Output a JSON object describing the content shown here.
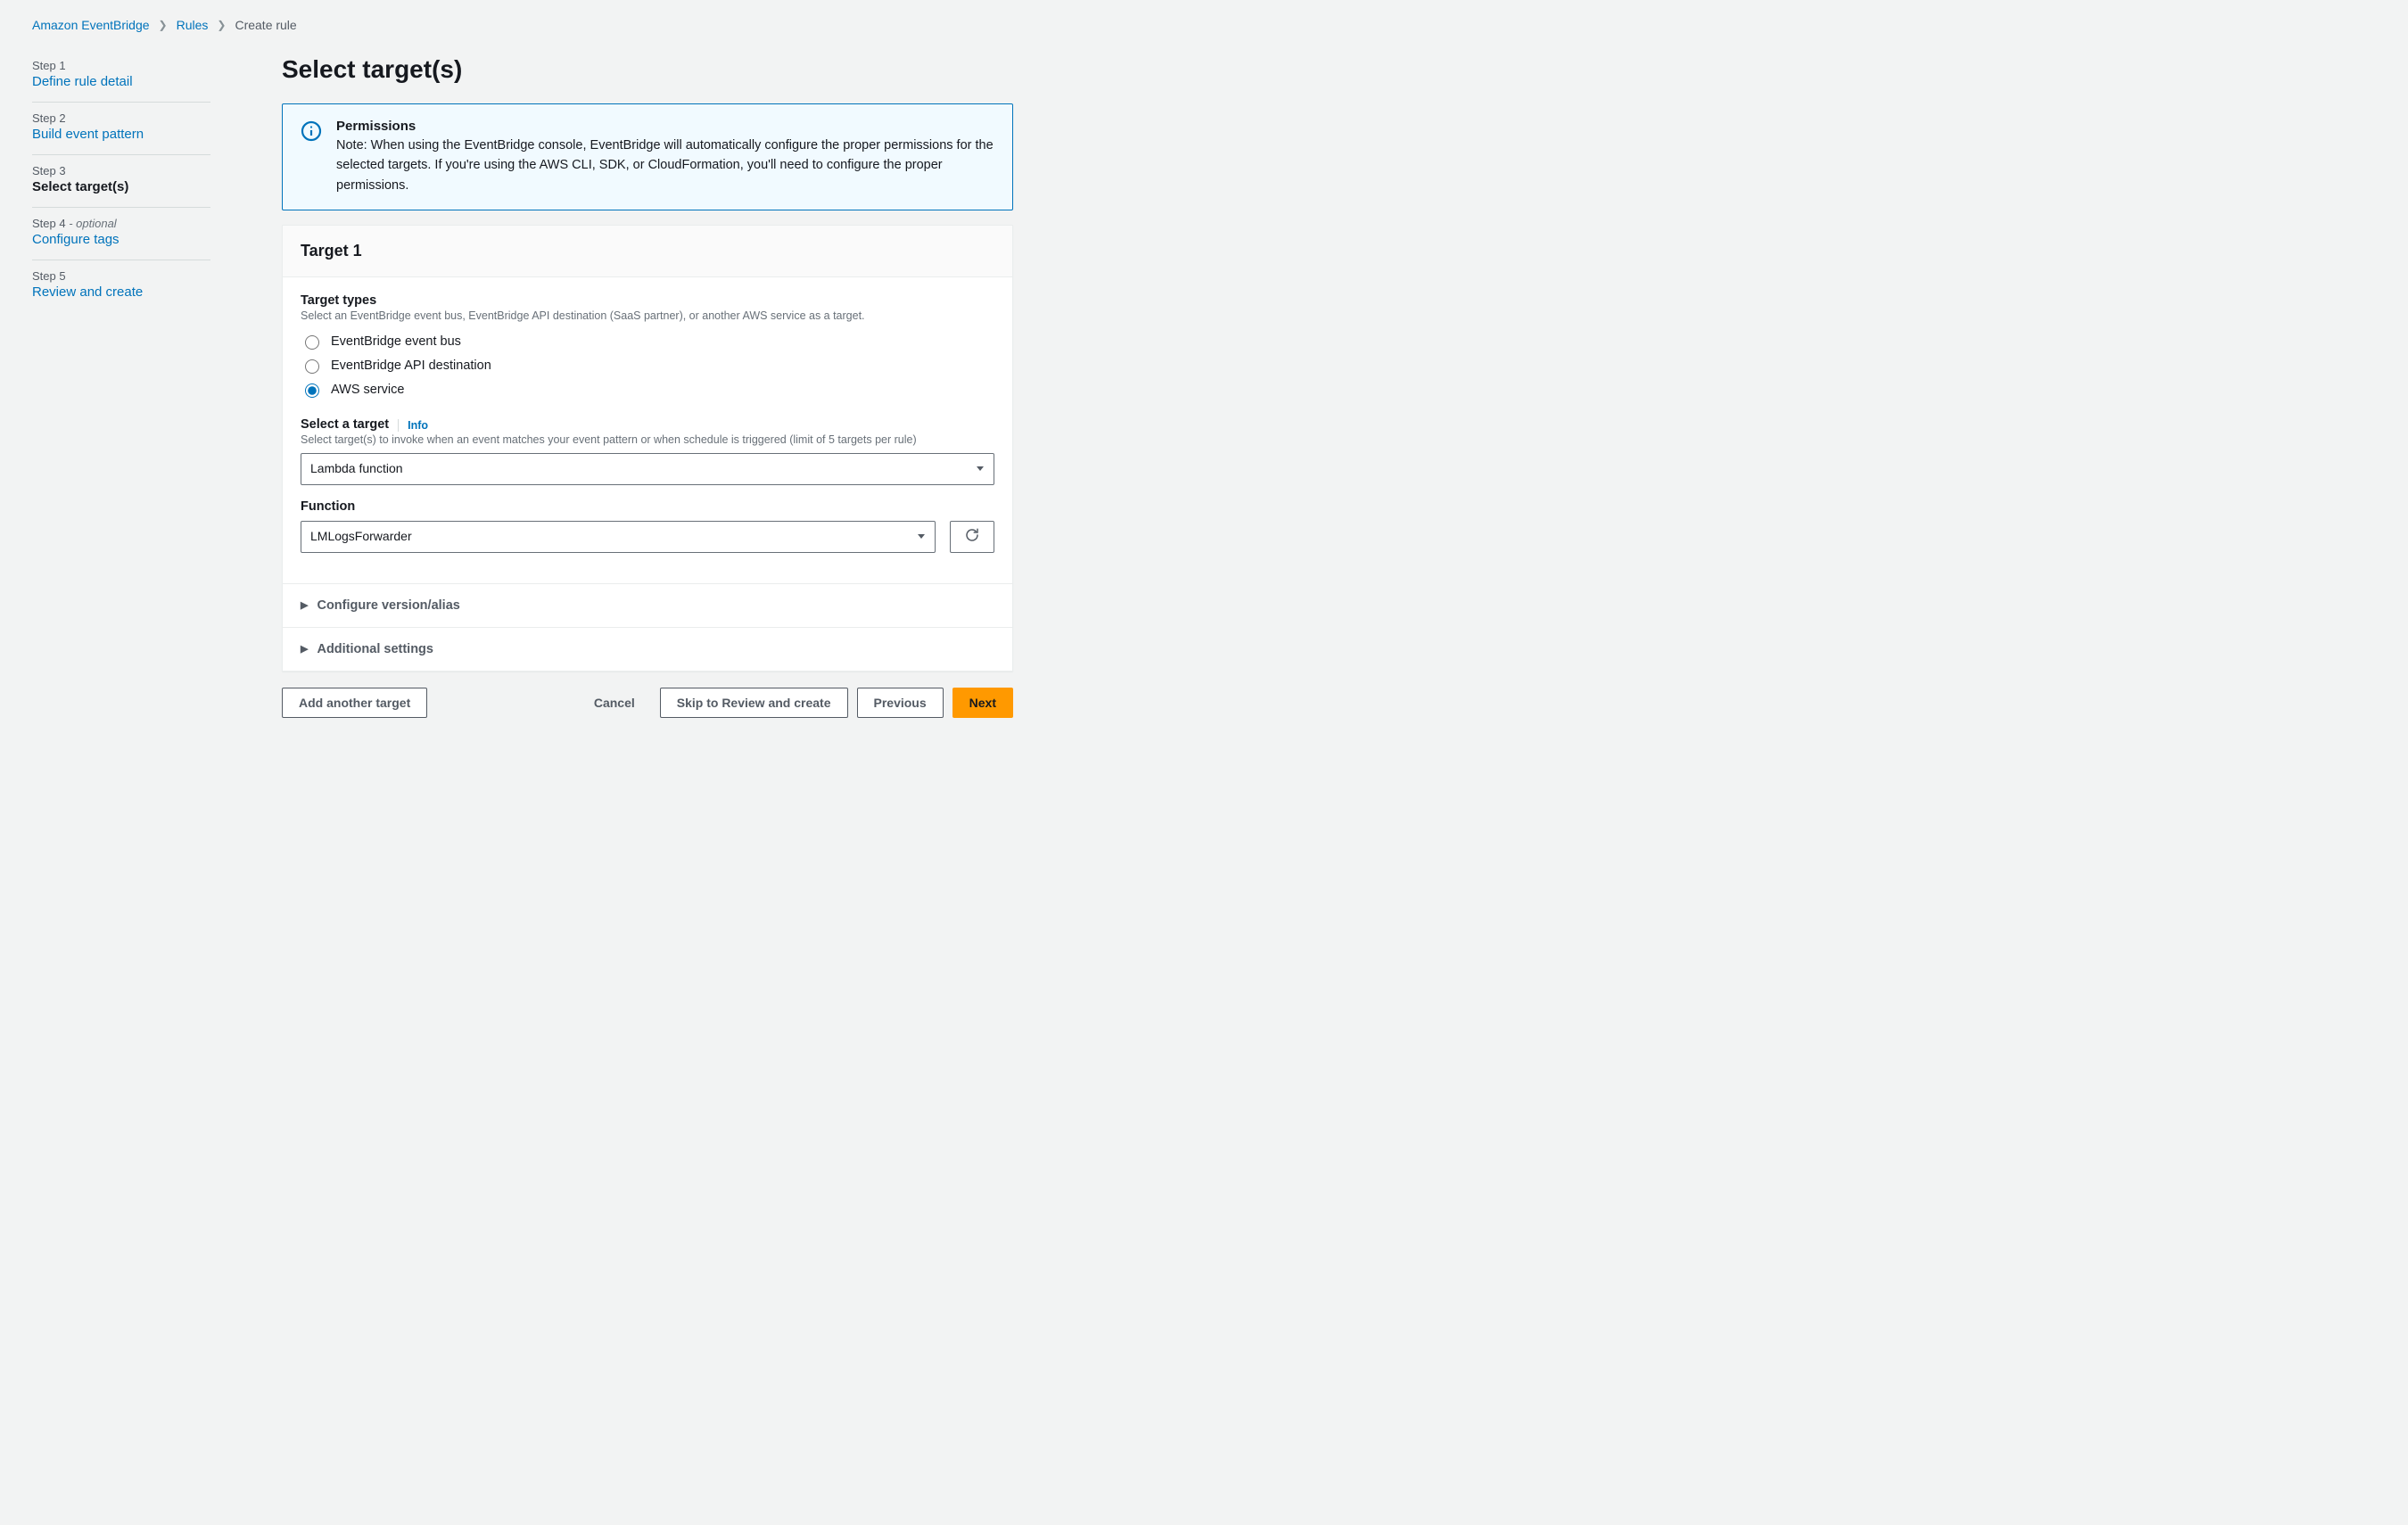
{
  "breadcrumb": {
    "items": [
      "Amazon EventBridge",
      "Rules"
    ],
    "current": "Create rule"
  },
  "steps": [
    {
      "num": "Step 1",
      "title": "Define rule detail",
      "active": false,
      "optional": false
    },
    {
      "num": "Step 2",
      "title": "Build event pattern",
      "active": false,
      "optional": false
    },
    {
      "num": "Step 3",
      "title": "Select target(s)",
      "active": true,
      "optional": false
    },
    {
      "num": "Step 4",
      "title": "Configure tags",
      "active": false,
      "optional": true,
      "optional_label": " - optional"
    },
    {
      "num": "Step 5",
      "title": "Review and create",
      "active": false,
      "optional": false
    }
  ],
  "page_title": "Select target(s)",
  "alert": {
    "title": "Permissions",
    "text": "Note: When using the EventBridge console, EventBridge will automatically configure the proper permissions for the selected targets. If you're using the AWS CLI, SDK, or CloudFormation, you'll need to configure the proper permissions."
  },
  "target_panel": {
    "heading": "Target 1",
    "target_types": {
      "label": "Target types",
      "desc": "Select an EventBridge event bus, EventBridge API destination (SaaS partner), or another AWS service as a target.",
      "options": [
        {
          "label": "EventBridge event bus",
          "selected": false
        },
        {
          "label": "EventBridge API destination",
          "selected": false
        },
        {
          "label": "AWS service",
          "selected": true
        }
      ]
    },
    "select_target": {
      "label": "Select a target",
      "info": "Info",
      "desc": "Select target(s) to invoke when an event matches your event pattern or when schedule is triggered (limit of 5 targets per rule)",
      "value": "Lambda function"
    },
    "function": {
      "label": "Function",
      "value": "LMLogsForwarder"
    },
    "collapse": {
      "version": "Configure version/alias",
      "additional": "Additional settings"
    }
  },
  "actions": {
    "add_target": "Add another target",
    "cancel": "Cancel",
    "skip": "Skip to Review and create",
    "previous": "Previous",
    "next": "Next"
  }
}
